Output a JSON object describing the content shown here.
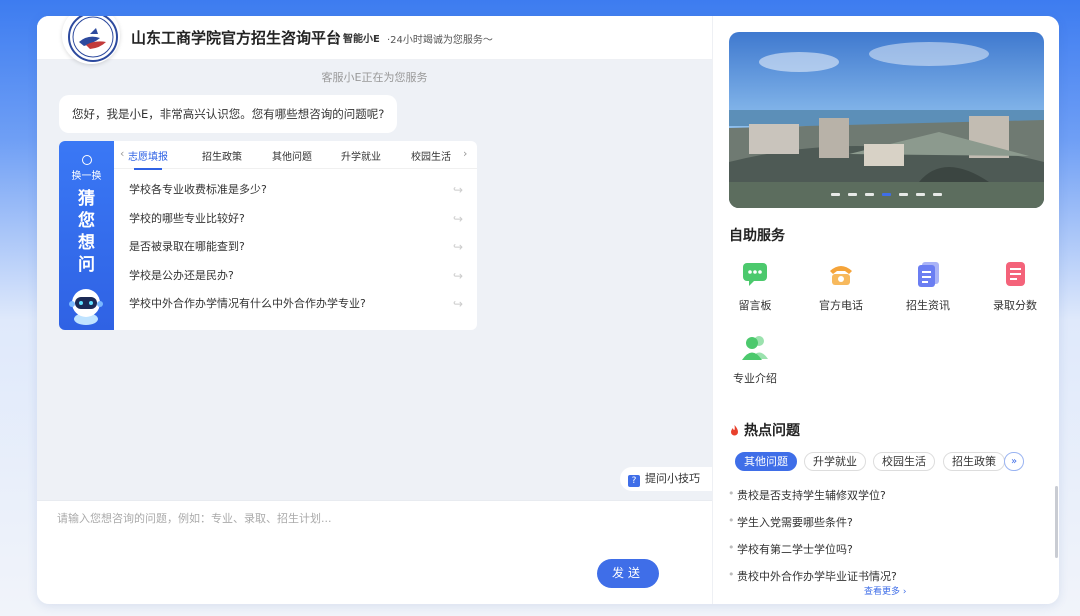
{
  "header": {
    "title": "山东工商学院官方招生咨询平台",
    "brand": "智能小E",
    "slogan": "·24小时竭诚为您服务～"
  },
  "chat": {
    "service_note": "客服小E正在为您服务",
    "greeting": "您好，我是小E，非常高兴认识您。您有哪些想咨询的问题呢?",
    "guess": {
      "refresh_label": "换一换",
      "title_chars": [
        "猜",
        "您",
        "想",
        "问"
      ],
      "tabs": [
        {
          "label": "志愿填报",
          "active": true
        },
        {
          "label": "招生政策",
          "active": false
        },
        {
          "label": "其他问题",
          "active": false
        },
        {
          "label": "升学就业",
          "active": false
        },
        {
          "label": "校园生活",
          "active": false
        }
      ],
      "prev_arrow": "‹",
      "next_arrow": "›",
      "questions": [
        "学校各专业收费标准是多少?",
        "学校的哪些专业比较好?",
        "是否被录取在哪能查到?",
        "学校是公办还是民办?",
        "学校中外合作办学情况有什么中外合作办学专业?"
      ],
      "question_arrow": "↪"
    },
    "tips_label": "提问小技巧",
    "input_placeholder": "请输入您想咨询的问题，例如：专业、录取、招生计划...",
    "send_label": "发送"
  },
  "sidebar": {
    "banner_dot_count": 7,
    "banner_active_dot": 4,
    "self_service_title": "自助服务",
    "services": [
      {
        "label": "留言板",
        "icon": "message-board-icon",
        "color": "#4cc96d"
      },
      {
        "label": "官方电话",
        "icon": "phone-icon",
        "color": "#f5a43a"
      },
      {
        "label": "招生资讯",
        "icon": "news-icon",
        "color": "#6b7ef2"
      },
      {
        "label": "录取分数",
        "icon": "score-icon",
        "color": "#f4637a"
      },
      {
        "label": "专业介绍",
        "icon": "major-icon",
        "color": "#4cc96d"
      }
    ],
    "hot_title": "热点问题",
    "hot_tabs": [
      {
        "label": "其他问题",
        "active": true
      },
      {
        "label": "升学就业",
        "active": false
      },
      {
        "label": "校园生活",
        "active": false
      },
      {
        "label": "招生政策",
        "active": false
      }
    ],
    "hot_more_glyph": "»",
    "hot_questions": [
      "贵校是否支持学生辅修双学位?",
      "学生入党需要哪些条件?",
      "学校有第二学士学位吗?",
      "贵校中外合作办学毕业证书情况?"
    ],
    "more_label": "查看更多 ›"
  },
  "colors": {
    "accent": "#3f6ee8",
    "guess_side": "#2f62e4"
  }
}
